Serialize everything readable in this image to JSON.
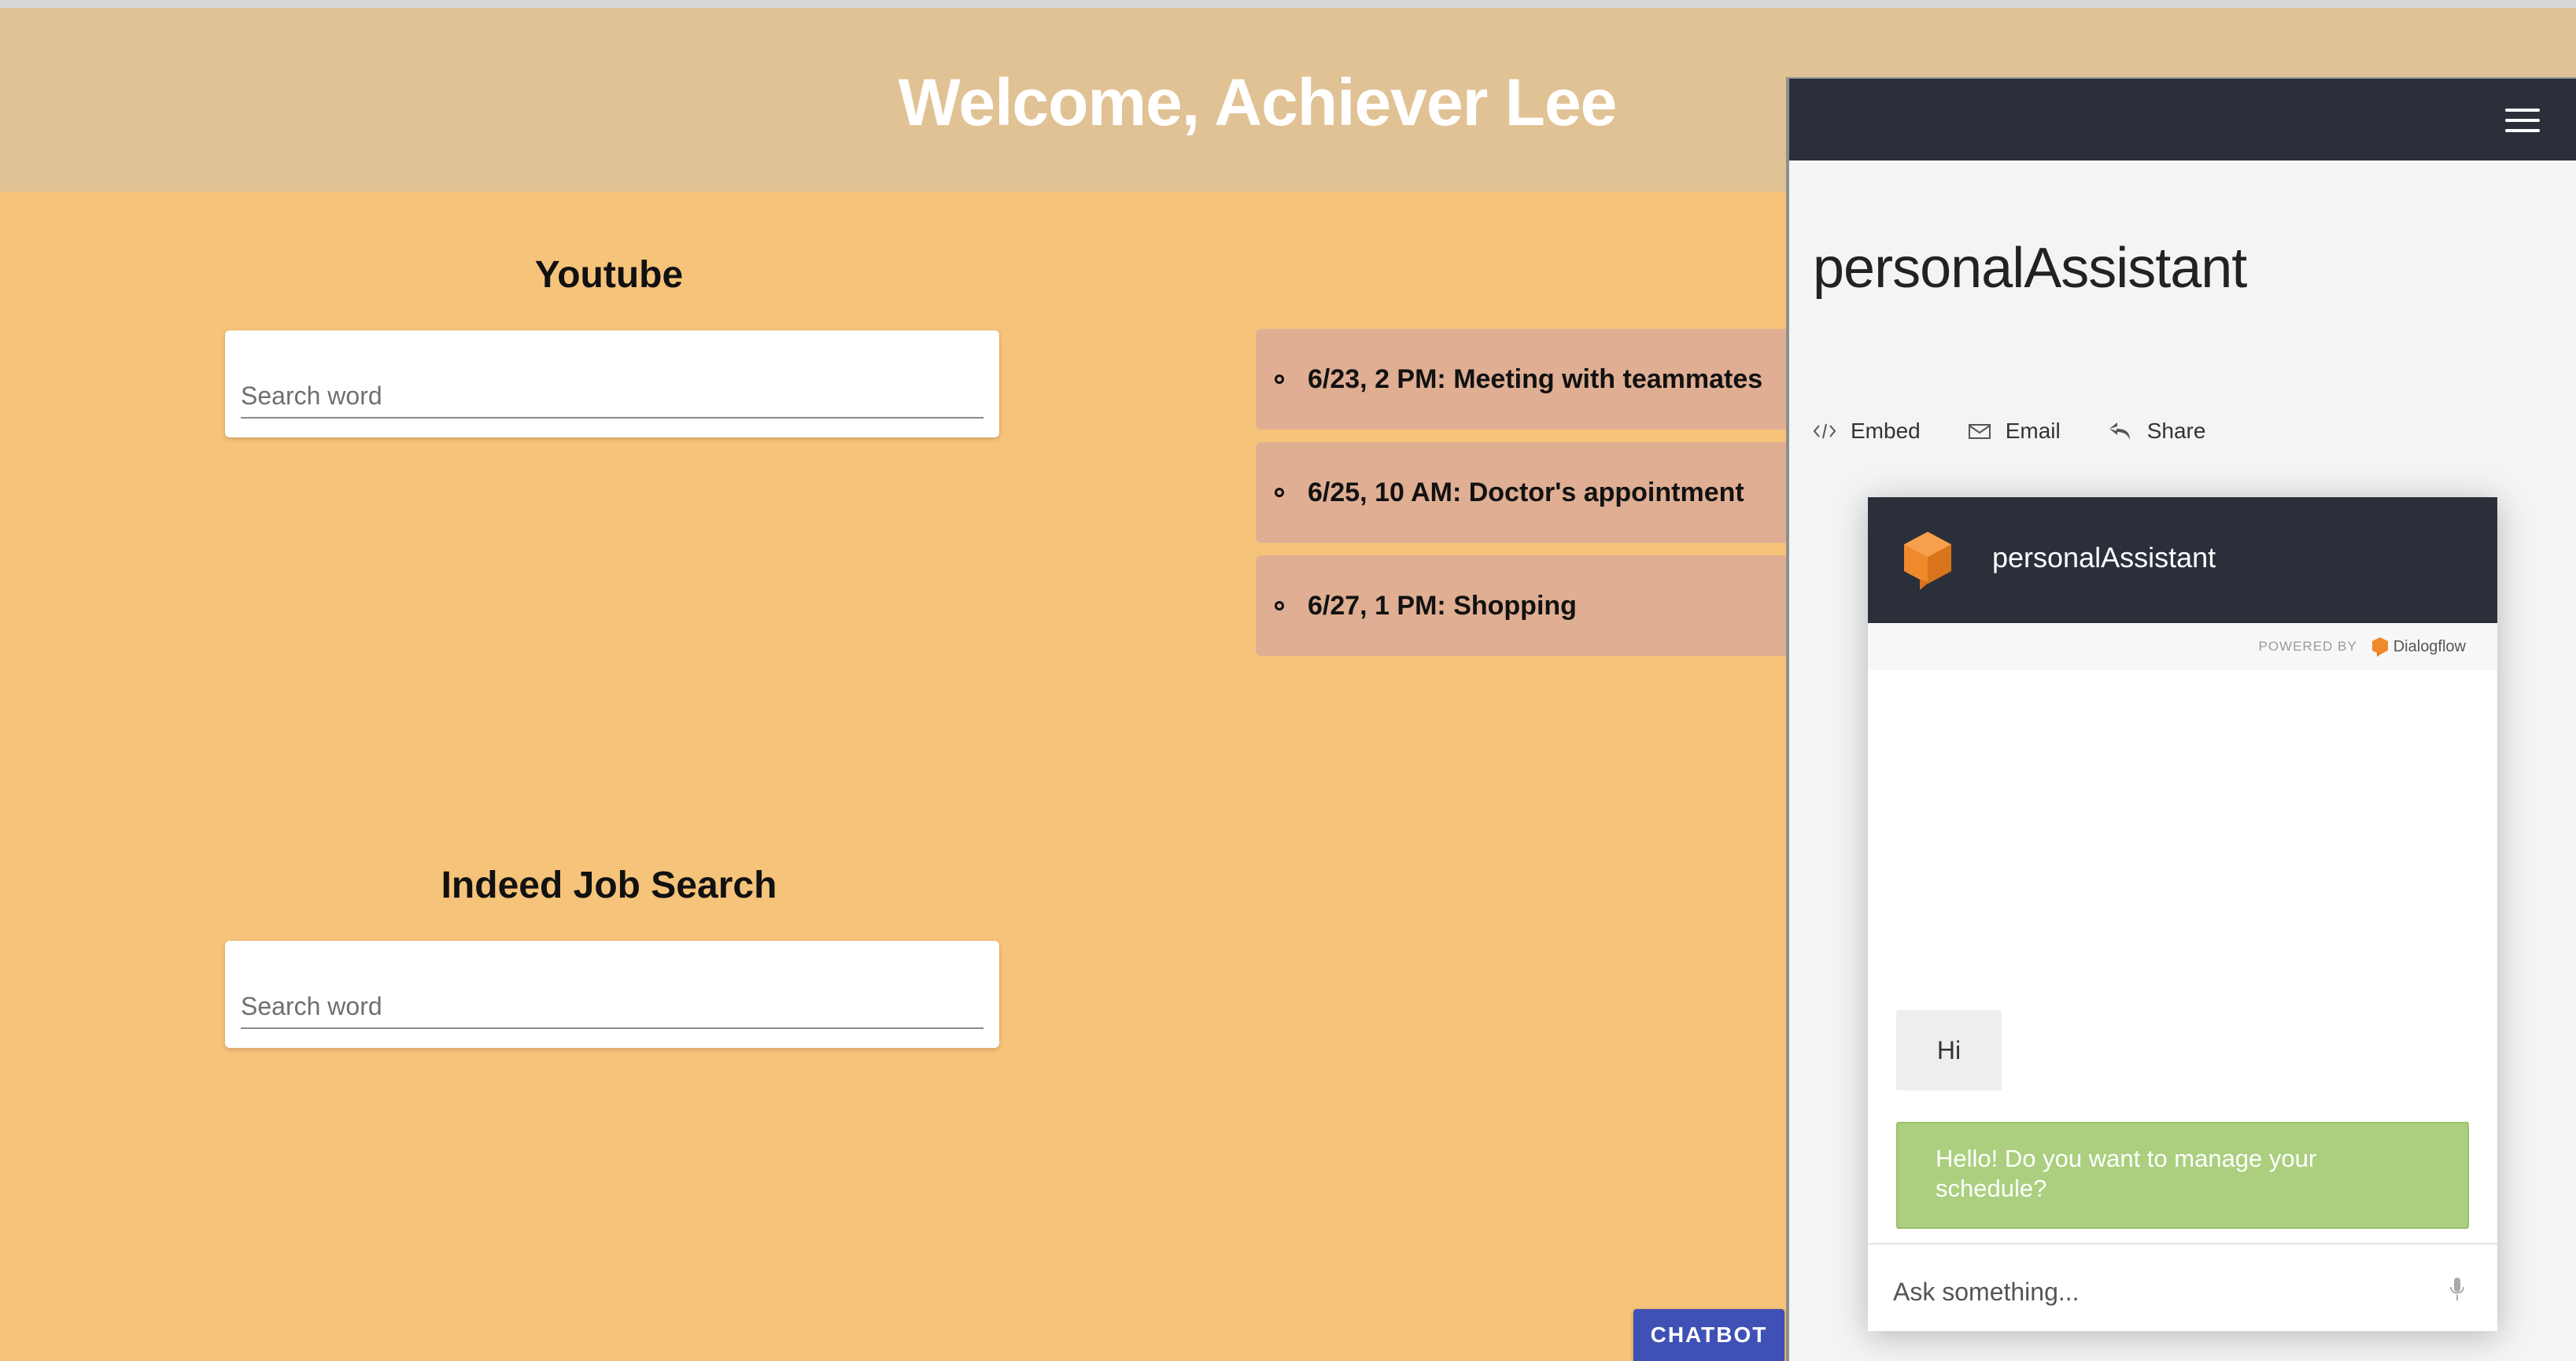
{
  "header": {
    "title": "Welcome, Achiever Lee"
  },
  "youtube": {
    "title": "Youtube",
    "placeholder": "Search word"
  },
  "indeed": {
    "title": "Indeed Job Search",
    "placeholder": "Search word"
  },
  "events": [
    {
      "text": "6/23, 2 PM: Meeting with teammates"
    },
    {
      "text": "6/25, 10 AM: Doctor's appointment"
    },
    {
      "text": "6/27, 1 PM: Shopping"
    }
  ],
  "chatbot_button": {
    "label": "CHATBOT"
  },
  "dialogflow": {
    "title": "personalAssistant",
    "actions": {
      "embed": "Embed",
      "email": "Email",
      "share": "Share"
    },
    "widget": {
      "name": "personalAssistant",
      "powered_by": "POWERED BY",
      "brand": "Dialogflow",
      "messages": {
        "user": "Hi",
        "bot": "Hello! Do you want to manage your schedule?"
      },
      "input_placeholder": "Ask something..."
    }
  },
  "colors": {
    "page_bg": "#f6c37a",
    "header_bg": "#e1c295",
    "event_bg": "#dfae93",
    "chatbot_button": "#3f51b5",
    "df_dark": "#2b2f3a",
    "bot_bubble": "#abcf7f",
    "dialogflow_orange": "#ef8a2c"
  }
}
